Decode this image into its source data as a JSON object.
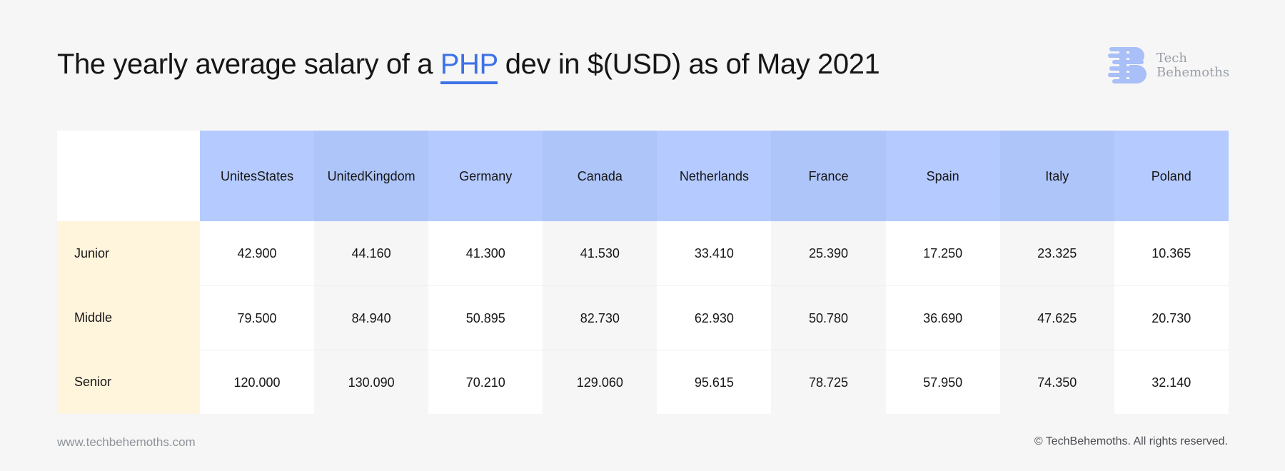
{
  "title": {
    "before": "The yearly average salary of a ",
    "highlight": "PHP",
    "after": " dev in $(USD) as of May 2021"
  },
  "logo": {
    "line1": "Tech",
    "line2": "Behemoths"
  },
  "colors": {
    "accent": "#3d72e8",
    "header_bg": "#b5caff",
    "row_label_bg": "#fff4dc",
    "cell_bg": "#ffffff",
    "alt_cell_bg": "#f6f6f6"
  },
  "chart_data": {
    "type": "table",
    "title": "The yearly average salary of a PHP dev in $(USD) as of May 2021",
    "columns": [
      "Unites States",
      "United Kingdom",
      "Germany",
      "Canada",
      "Netherlands",
      "France",
      "Spain",
      "Italy",
      "Poland"
    ],
    "column_lines": [
      [
        "Unites",
        "States"
      ],
      [
        "United",
        "Kingdom"
      ],
      [
        "Germany"
      ],
      [
        "Canada"
      ],
      [
        "Netherlands"
      ],
      [
        "France"
      ],
      [
        "Spain"
      ],
      [
        "Italy"
      ],
      [
        "Poland"
      ]
    ],
    "rows": [
      {
        "label": "Junior",
        "values": [
          "42.900",
          "44.160",
          "41.300",
          "41.530",
          "33.410",
          "25.390",
          "17.250",
          "23.325",
          "10.365"
        ]
      },
      {
        "label": "Middle",
        "values": [
          "79.500",
          "84.940",
          "50.895",
          "82.730",
          "62.930",
          "50.780",
          "36.690",
          "47.625",
          "20.730"
        ]
      },
      {
        "label": "Senior",
        "values": [
          "120.000",
          "130.090",
          "70.210",
          "129.060",
          "95.615",
          "78.725",
          "57.950",
          "74.350",
          "32.140"
        ]
      }
    ]
  },
  "footer": {
    "website": "www.techbehemoths.com",
    "copyright": "© TechBehemoths. All rights reserved."
  }
}
